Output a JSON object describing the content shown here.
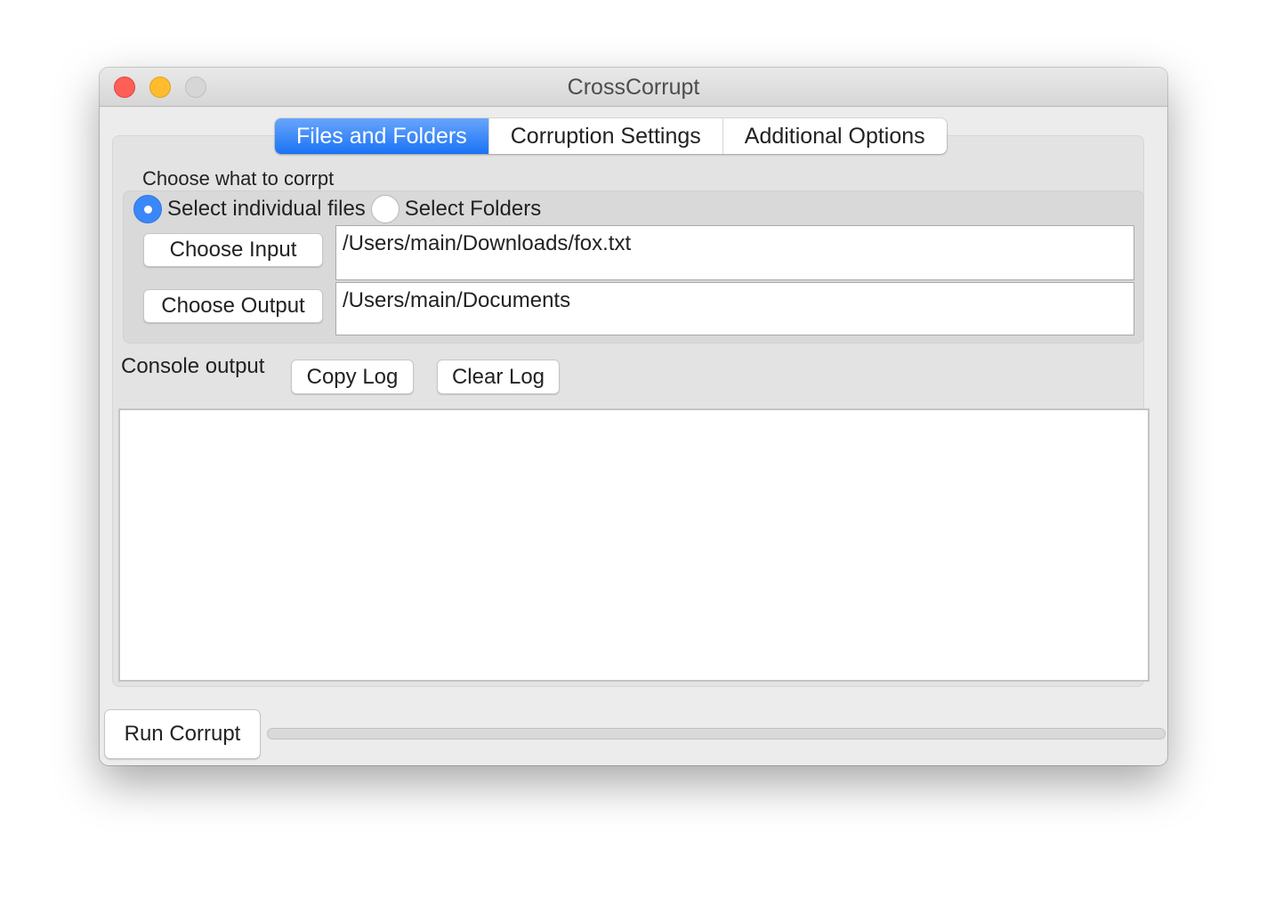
{
  "window": {
    "title": "CrossCorrupt",
    "controls": [
      "close",
      "minimize",
      "zoom"
    ]
  },
  "tabs": [
    {
      "label": "Files and Folders",
      "active": true
    },
    {
      "label": "Corruption Settings",
      "active": false
    },
    {
      "label": "Additional Options",
      "active": false
    }
  ],
  "files_tab": {
    "section_label": "Choose what to corrpt",
    "mode_options": [
      {
        "label": "Select individual files",
        "checked": true
      },
      {
        "label": "Select Folders",
        "checked": false
      }
    ],
    "choose_input_label": "Choose Input",
    "input_path": "/Users/main/Downloads/fox.txt",
    "choose_output_label": "Choose Output",
    "output_path": "/Users/main/Documents",
    "console_label": "Console output",
    "copy_log_label": "Copy Log",
    "clear_log_label": "Clear Log",
    "console_text": ""
  },
  "footer": {
    "run_label": "Run Corrupt",
    "progress_percent": 0
  },
  "colors": {
    "accent": "#1a73f5",
    "close": "#fe5f57",
    "minimize": "#febc2e",
    "zoom_disabled": "#d6d6d6"
  }
}
